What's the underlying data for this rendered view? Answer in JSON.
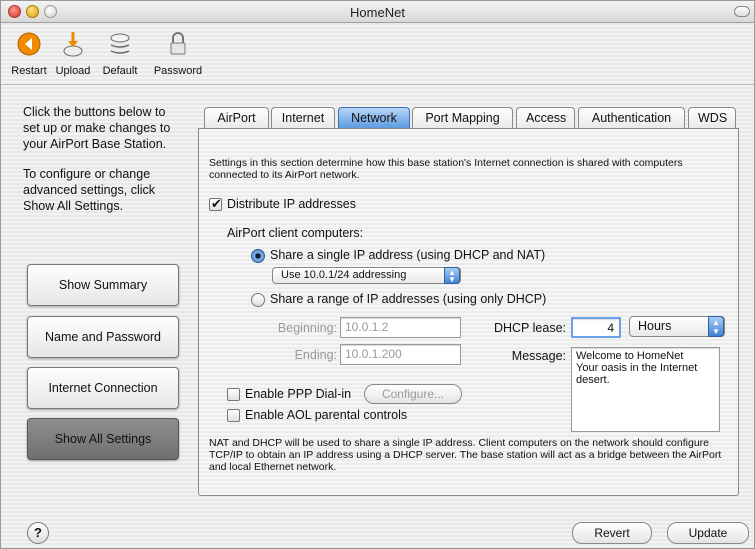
{
  "window": {
    "title": "HomeNet"
  },
  "toolbar": {
    "items": [
      {
        "label": "Restart",
        "icon": "restart-icon"
      },
      {
        "label": "Upload",
        "icon": "upload-icon"
      },
      {
        "label": "Default",
        "icon": "default-icon"
      },
      {
        "label": "Password",
        "icon": "lock-icon"
      }
    ]
  },
  "sidebar": {
    "intro_text": "Click the buttons below to set up or make changes to your AirPort Base Station.",
    "advanced_text": "To configure or change advanced settings, click Show All Settings.",
    "buttons": [
      {
        "label": "Show Summary"
      },
      {
        "label": "Name and Password"
      },
      {
        "label": "Internet Connection"
      },
      {
        "label": "Show All Settings"
      }
    ]
  },
  "tabs": [
    {
      "label": "AirPort"
    },
    {
      "label": "Internet"
    },
    {
      "label": "Network"
    },
    {
      "label": "Port Mapping"
    },
    {
      "label": "Access"
    },
    {
      "label": "Authentication"
    },
    {
      "label": "WDS"
    }
  ],
  "network": {
    "description": "Settings in this section determine how this base station's Internet connection is shared with computers connected to its AirPort network.",
    "distribute_label": "Distribute IP addresses",
    "client_label": "AirPort client computers:",
    "share_single_label": "Share a single IP address (using DHCP and NAT)",
    "addressing_value": "Use 10.0.1/24 addressing",
    "share_range_label": "Share a range of IP addresses (using only DHCP)",
    "beginning_label": "Beginning:",
    "beginning_value": "10.0.1.2",
    "ending_label": "Ending:",
    "ending_value": "10.0.1.200",
    "dhcp_lease_label": "DHCP lease:",
    "dhcp_lease_value": "4",
    "dhcp_unit": "Hours",
    "message_label": "Message:",
    "message_value": "Welcome to HomeNet\nYour oasis in the Internet desert.",
    "ppp_label": "Enable PPP Dial-in",
    "configure_label": "Configure...",
    "aol_label": "Enable AOL parental controls",
    "footer_text": "NAT and DHCP will be used to share a single IP address. Client computers on the network should configure TCP/IP to obtain an IP address using a DHCP server. The base station will act as a bridge between the AirPort and local Ethernet network."
  },
  "bottom": {
    "help_label": "?",
    "revert_label": "Revert",
    "update_label": "Update"
  },
  "colors": {
    "accent": "#5d9be0",
    "selected_sidebar": "#7a7a7a"
  }
}
